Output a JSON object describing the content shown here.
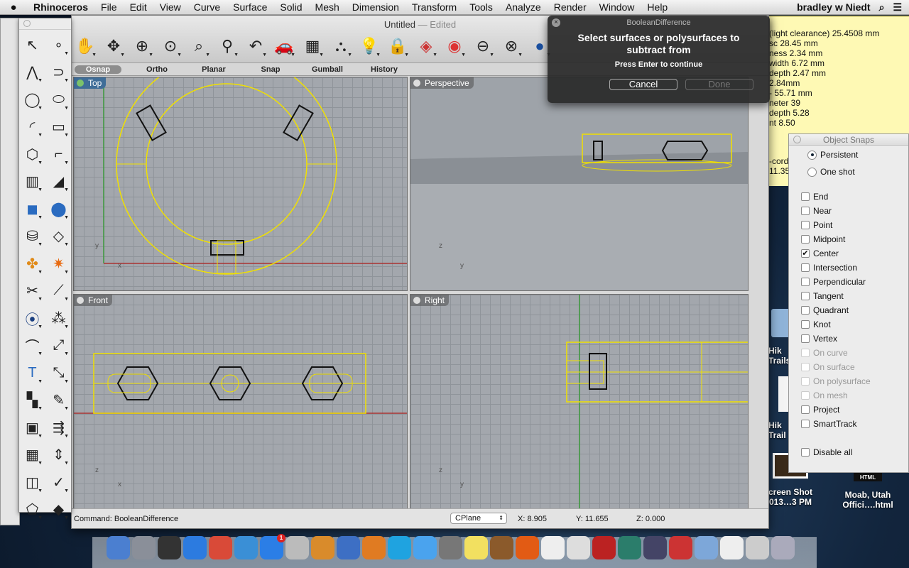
{
  "menubar": {
    "apple": "",
    "app": "Rhinoceros",
    "items": [
      "File",
      "Edit",
      "View",
      "Curve",
      "Surface",
      "Solid",
      "Mesh",
      "Dimension",
      "Transform",
      "Tools",
      "Analyze",
      "Render",
      "Window",
      "Help"
    ],
    "user": "bradley w Niedt"
  },
  "note": {
    "lines": [
      "(light clearance) 25.4508 mm",
      "sc 28.45 mm",
      "ness 2.34 mm",
      "width 6.72 mm",
      "depth 2.47 mm",
      "2.84mm",
      "- 55.71 mm",
      "neter 39",
      "depth 5.28",
      "nt 8.50"
    ],
    "lower": [
      "-cord",
      "11.35"
    ]
  },
  "window": {
    "title": "Untitled",
    "edited": "— Edited"
  },
  "toolbar": {
    "icons": [
      "hand-pan-icon",
      "rotate-view-icon",
      "zoom-in-out-icon",
      "zoom-window-icon",
      "zoom-extents-icon",
      "zoom-selected-icon",
      "undo-view-icon",
      "car-icon",
      "cplane-icon",
      "gumball-icon",
      "light-icon",
      "lock-icon",
      "layer-icon",
      "color-wheel-icon",
      "sphere-wire-icon",
      "globe-icon",
      "render-sphere-icon"
    ]
  },
  "tabs": [
    {
      "label": "Osnap",
      "active": true
    },
    {
      "label": "Ortho"
    },
    {
      "label": "Planar"
    },
    {
      "label": "Snap"
    },
    {
      "label": "Gumball"
    },
    {
      "label": "History"
    }
  ],
  "viewports": {
    "top": "Top",
    "perspective": "Perspective",
    "front": "Front",
    "right": "Right"
  },
  "status": {
    "command": "Command:  BooleanDifference",
    "cplane": "CPlane",
    "x": "X: 8.905",
    "y": "Y: 11.655",
    "z": "Z: 0.000"
  },
  "palette": {
    "icons": [
      "select-arrow-icon",
      "point-icon",
      "polyline-icon",
      "curve-icon",
      "circle-icon",
      "ellipse-icon",
      "arc-icon",
      "rectangle-icon",
      "polygon-icon",
      "fillet-curve-icon",
      "surface-icon",
      "loft-icon",
      "box-icon",
      "sphere-icon",
      "cylinder-icon",
      "plane-surface-icon",
      "join-icon",
      "explode-icon",
      "trim-icon",
      "split-icon",
      "boolean-icon",
      "array-icon",
      "offset-icon",
      "move-icon",
      "text-icon",
      "scale-icon",
      "group-icon",
      "edit-points-icon",
      "solid-edit-icon",
      "analyze-icon",
      "grid-array-icon",
      "align-icon",
      "dimension-icon",
      "check-icon",
      "mesh-icon",
      "render-icon"
    ]
  },
  "dialog": {
    "title": "BooleanDifference",
    "message": "Select surfaces or polysurfaces to subtract from",
    "sub": "Press Enter to continue",
    "cancel": "Cancel",
    "done": "Done"
  },
  "snaps": {
    "title": "Object Snaps",
    "modes": [
      {
        "label": "Persistent",
        "on": true
      },
      {
        "label": "One shot",
        "on": false
      }
    ],
    "items": [
      {
        "label": "End"
      },
      {
        "label": "Near"
      },
      {
        "label": "Point"
      },
      {
        "label": "Midpoint"
      },
      {
        "label": "Center",
        "checked": true
      },
      {
        "label": "Intersection"
      },
      {
        "label": "Perpendicular"
      },
      {
        "label": "Tangent"
      },
      {
        "label": "Quadrant"
      },
      {
        "label": "Knot"
      },
      {
        "label": "Vertex"
      },
      {
        "label": "On curve",
        "disabled": true
      },
      {
        "label": "On surface",
        "disabled": true
      },
      {
        "label": "On polysurface",
        "disabled": true
      },
      {
        "label": "On mesh",
        "disabled": true
      },
      {
        "label": "Project"
      },
      {
        "label": "SmartTrack"
      }
    ],
    "disable_all": "Disable all"
  },
  "desktop": [
    {
      "label": "Hik\nTrails"
    },
    {
      "label": "Hik\nTrail"
    },
    {
      "label": "creen Shot\n013…3 PM"
    },
    {
      "label": "Moab, Utah\nOffici….html"
    }
  ],
  "dock": {
    "apps": [
      {
        "name": "finder",
        "color": "#4b7fd0"
      },
      {
        "name": "launchpad",
        "color": "#8a8f99"
      },
      {
        "name": "dashboard",
        "color": "#333"
      },
      {
        "name": "itunes",
        "color": "#2c7be0"
      },
      {
        "name": "chrome",
        "color": "#d94a38"
      },
      {
        "name": "safari",
        "color": "#3a8fd6"
      },
      {
        "name": "app-store",
        "color": "#2b7ee6",
        "badge": "1"
      },
      {
        "name": "rhino",
        "color": "#bbb"
      },
      {
        "name": "xcode",
        "color": "#d98b2b"
      },
      {
        "name": "word",
        "color": "#3d6fc4"
      },
      {
        "name": "powerpoint",
        "color": "#e07b22"
      },
      {
        "name": "skype",
        "color": "#1fa3e0"
      },
      {
        "name": "messages",
        "color": "#4aa3ee"
      },
      {
        "name": "system-preferences",
        "color": "#777"
      },
      {
        "name": "stickies",
        "color": "#f2e060"
      },
      {
        "name": "iphoto",
        "color": "#8b5a2b"
      },
      {
        "name": "audacity",
        "color": "#e25b14"
      },
      {
        "name": "calendar",
        "color": "#eee"
      },
      {
        "name": "reminders",
        "color": "#ddd"
      },
      {
        "name": "photo-booth",
        "color": "#b22"
      },
      {
        "name": "time-machine",
        "color": "#2b7d6b"
      },
      {
        "name": "book",
        "color": "#446"
      },
      {
        "name": "solitaire",
        "color": "#c33"
      },
      {
        "name": "folder",
        "color": "#7da7d9"
      },
      {
        "name": "document",
        "color": "#eee"
      },
      {
        "name": "mail-photo",
        "color": "#ccc"
      },
      {
        "name": "trash",
        "color": "#aab"
      }
    ]
  }
}
